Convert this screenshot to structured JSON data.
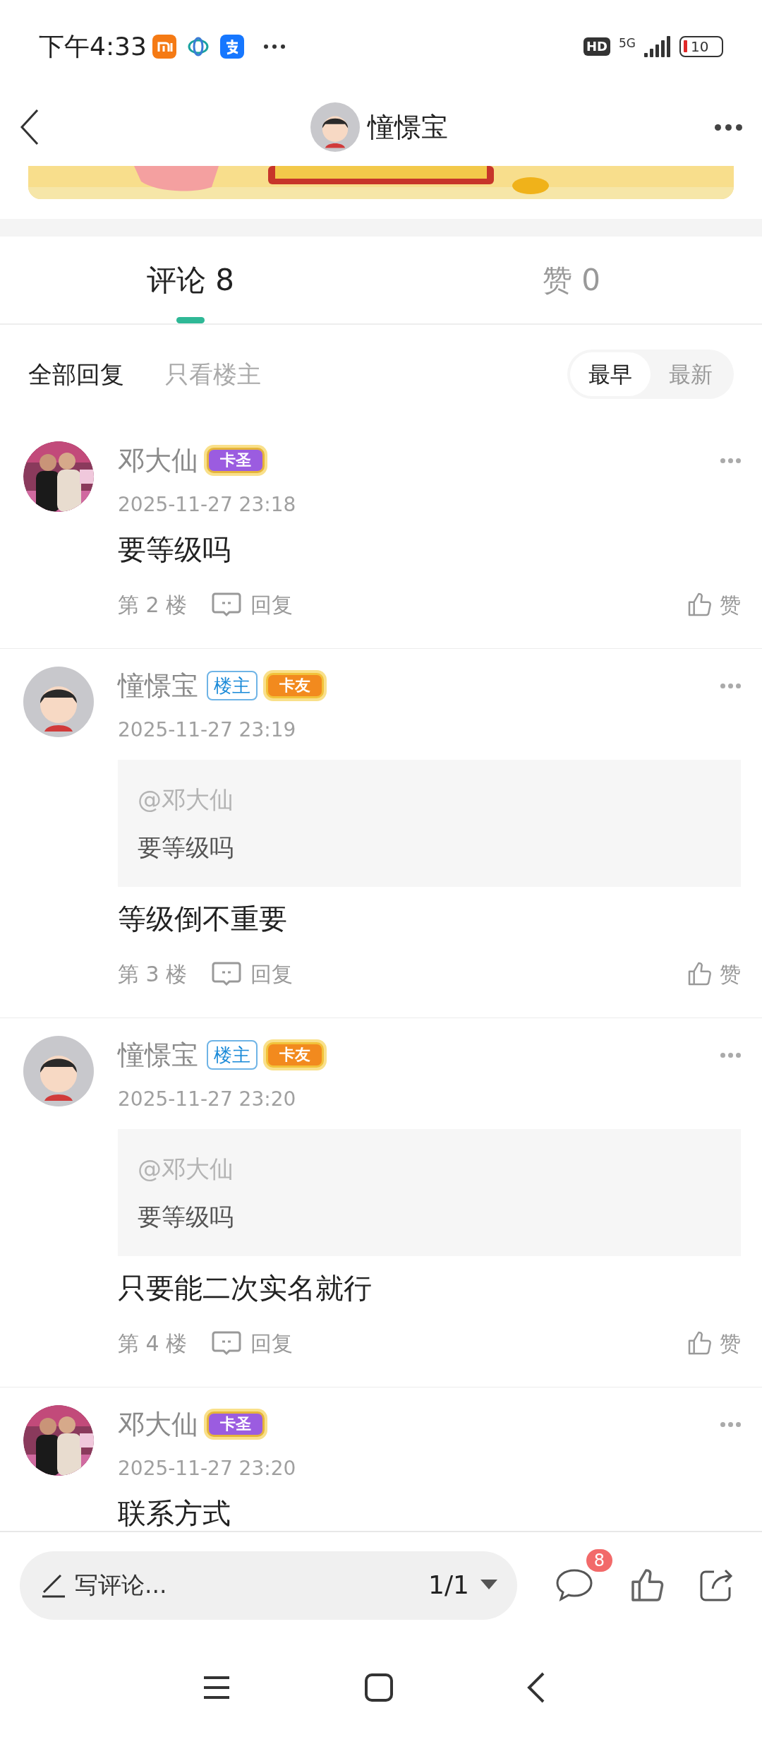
{
  "status_bar": {
    "time": "下午4:33",
    "network_badge": "HD",
    "network_type": "5G",
    "battery": "10"
  },
  "header": {
    "title": "憧憬宝"
  },
  "tabs": [
    {
      "label": "评论 8",
      "selected": true
    },
    {
      "label": "赞 0",
      "selected": false
    }
  ],
  "filters": [
    {
      "label": "全部回复",
      "selected": true
    },
    {
      "label": "只看楼主",
      "selected": false
    }
  ],
  "sort": [
    {
      "label": "最早",
      "selected": true
    },
    {
      "label": "最新",
      "selected": false
    }
  ],
  "comments": [
    {
      "author": "邓大仙",
      "rank_badge": {
        "label": "卡圣",
        "kind": "saint"
      },
      "date": "2025-11-27 23:18",
      "text": "要等级吗",
      "floor": "第 2 楼",
      "reply": "回复",
      "like": "赞"
    },
    {
      "author": "憧憬宝",
      "avatar": {
        "kind": "cartoon"
      },
      "op_tag": "楼主",
      "rank_badge": {
        "label": "卡友",
        "kind": "friend"
      },
      "date": "2025-11-27 23:19",
      "quote": {
        "mention": "@邓大仙",
        "text": "要等级吗"
      },
      "text": "等级倒不重要",
      "floor": "第 3 楼",
      "reply": "回复",
      "like": "赞"
    },
    {
      "author": "憧憬宝",
      "avatar": {
        "kind": "cartoon"
      },
      "op_tag": "楼主",
      "rank_badge": {
        "label": "卡友",
        "kind": "friend"
      },
      "date": "2025-11-27 23:20",
      "quote": {
        "mention": "@邓大仙",
        "text": "要等级吗"
      },
      "text": "只要能二次实名就行",
      "floor": "第 4 楼",
      "reply": "回复",
      "like": "赞"
    },
    {
      "author": "邓大仙",
      "rank_badge": {
        "label": "卡圣",
        "kind": "saint"
      },
      "date": "2025-11-27 23:20",
      "text": "联系方式"
    }
  ],
  "bottom_bar": {
    "placeholder": "写评论...",
    "page": "1/1",
    "comment_count": "8"
  }
}
